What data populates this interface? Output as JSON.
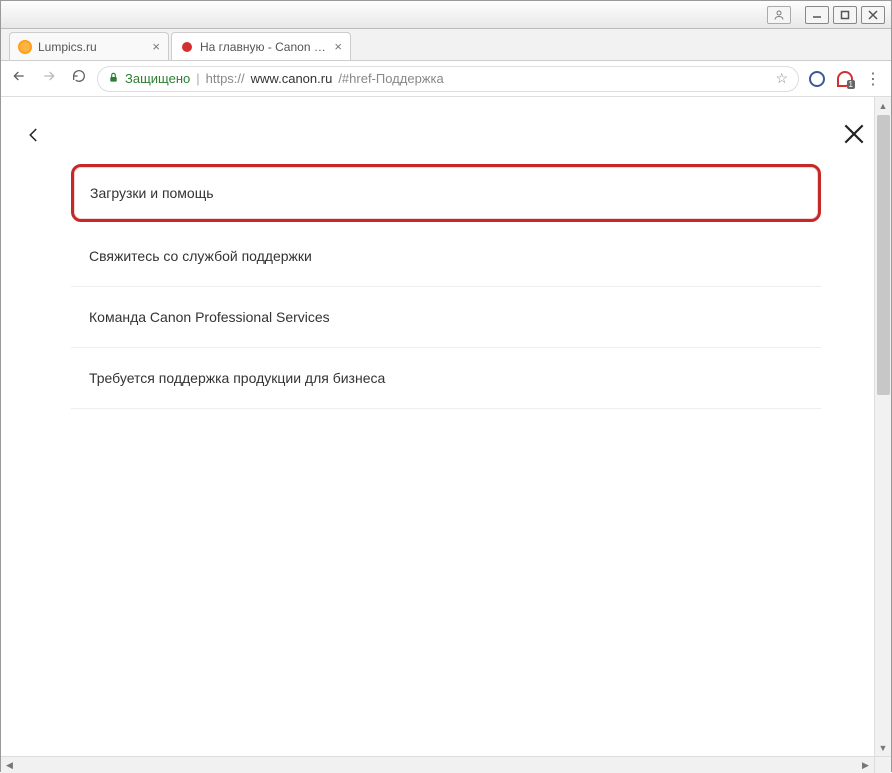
{
  "window": {
    "user_icon": "user"
  },
  "tabs": [
    {
      "title": "Lumpics.ru",
      "favicon": "orange",
      "active": false
    },
    {
      "title": "На главную - Canon Рос",
      "favicon": "red",
      "active": true
    }
  ],
  "toolbar": {
    "secure_label": "Защищено",
    "url_protocol": "https://",
    "url_host": "www.canon.ru",
    "url_path": "/#href-Поддержка"
  },
  "extensions": {
    "badge": "1"
  },
  "page": {
    "menu": [
      {
        "label": "Загрузки и помощь",
        "highlighted": true
      },
      {
        "label": "Свяжитесь со службой поддержки",
        "highlighted": false
      },
      {
        "label": "Команда Canon Professional Services",
        "highlighted": false
      },
      {
        "label": "Требуется поддержка продукции для бизнеса",
        "highlighted": false
      }
    ]
  }
}
